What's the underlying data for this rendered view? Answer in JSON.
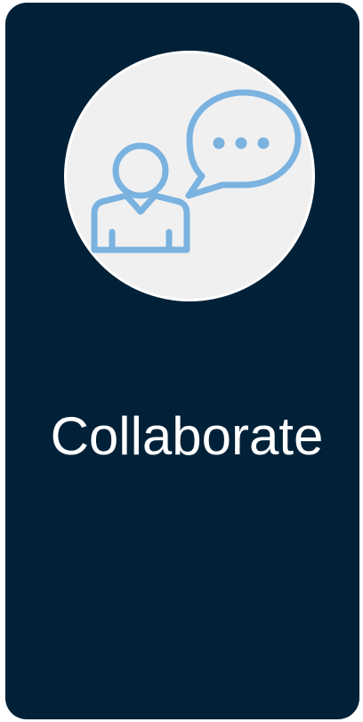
{
  "card": {
    "title": "Collaborate",
    "background_color": "#012138",
    "text_color": "#ffffff"
  },
  "icon": {
    "name": "person-chat-icon",
    "stroke_color": "#7ab2e0",
    "circle_color": "#f0f0f0"
  }
}
